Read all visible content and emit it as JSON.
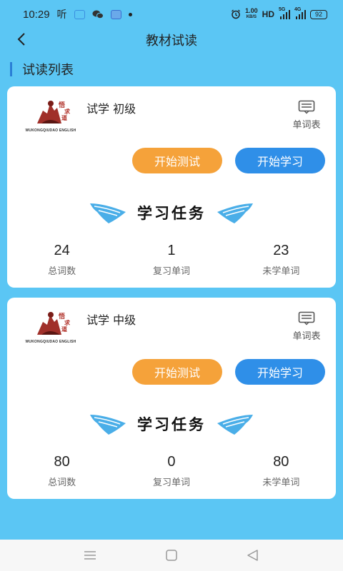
{
  "status_bar": {
    "time": "10:29",
    "carrier_icon_text": "听",
    "network_speed_value": "1.00",
    "network_speed_unit": "KB/S",
    "hd_label": "HD",
    "net_5g": "5G",
    "net_4g": "4G",
    "battery_level": "92"
  },
  "header": {
    "title": "教材试读"
  },
  "section": {
    "title": "试读列表"
  },
  "cards": [
    {
      "logo_brand": "WUKONGQIUDAO ENGLISH",
      "book_name": "试学 初级",
      "wordlist_label": "单词表",
      "test_button": "开始测试",
      "study_button": "开始学习",
      "task_title": "学习任务",
      "stats": [
        {
          "value": "24",
          "label": "总词数"
        },
        {
          "value": "1",
          "label": "复习单词"
        },
        {
          "value": "23",
          "label": "未学单词"
        }
      ]
    },
    {
      "logo_brand": "WUKONGQIUDAO ENGLISH",
      "book_name": "试学 中级",
      "wordlist_label": "单词表",
      "test_button": "开始测试",
      "study_button": "开始学习",
      "task_title": "学习任务",
      "stats": [
        {
          "value": "80",
          "label": "总词数"
        },
        {
          "value": "0",
          "label": "复习单词"
        },
        {
          "value": "80",
          "label": "未学单词"
        }
      ]
    }
  ],
  "colors": {
    "background": "#5bc6f4",
    "test_button": "#f5a23a",
    "study_button": "#2f8fe8",
    "accent_bar": "#2a7fd6",
    "wing": "#4aaee8"
  },
  "icons": {
    "back": "back-arrow-icon",
    "wordlist": "list-document-icon",
    "wing": "wing-icon",
    "nav_menu": "menu-lines-icon",
    "nav_home": "home-square-icon",
    "nav_back": "back-triangle-icon"
  }
}
